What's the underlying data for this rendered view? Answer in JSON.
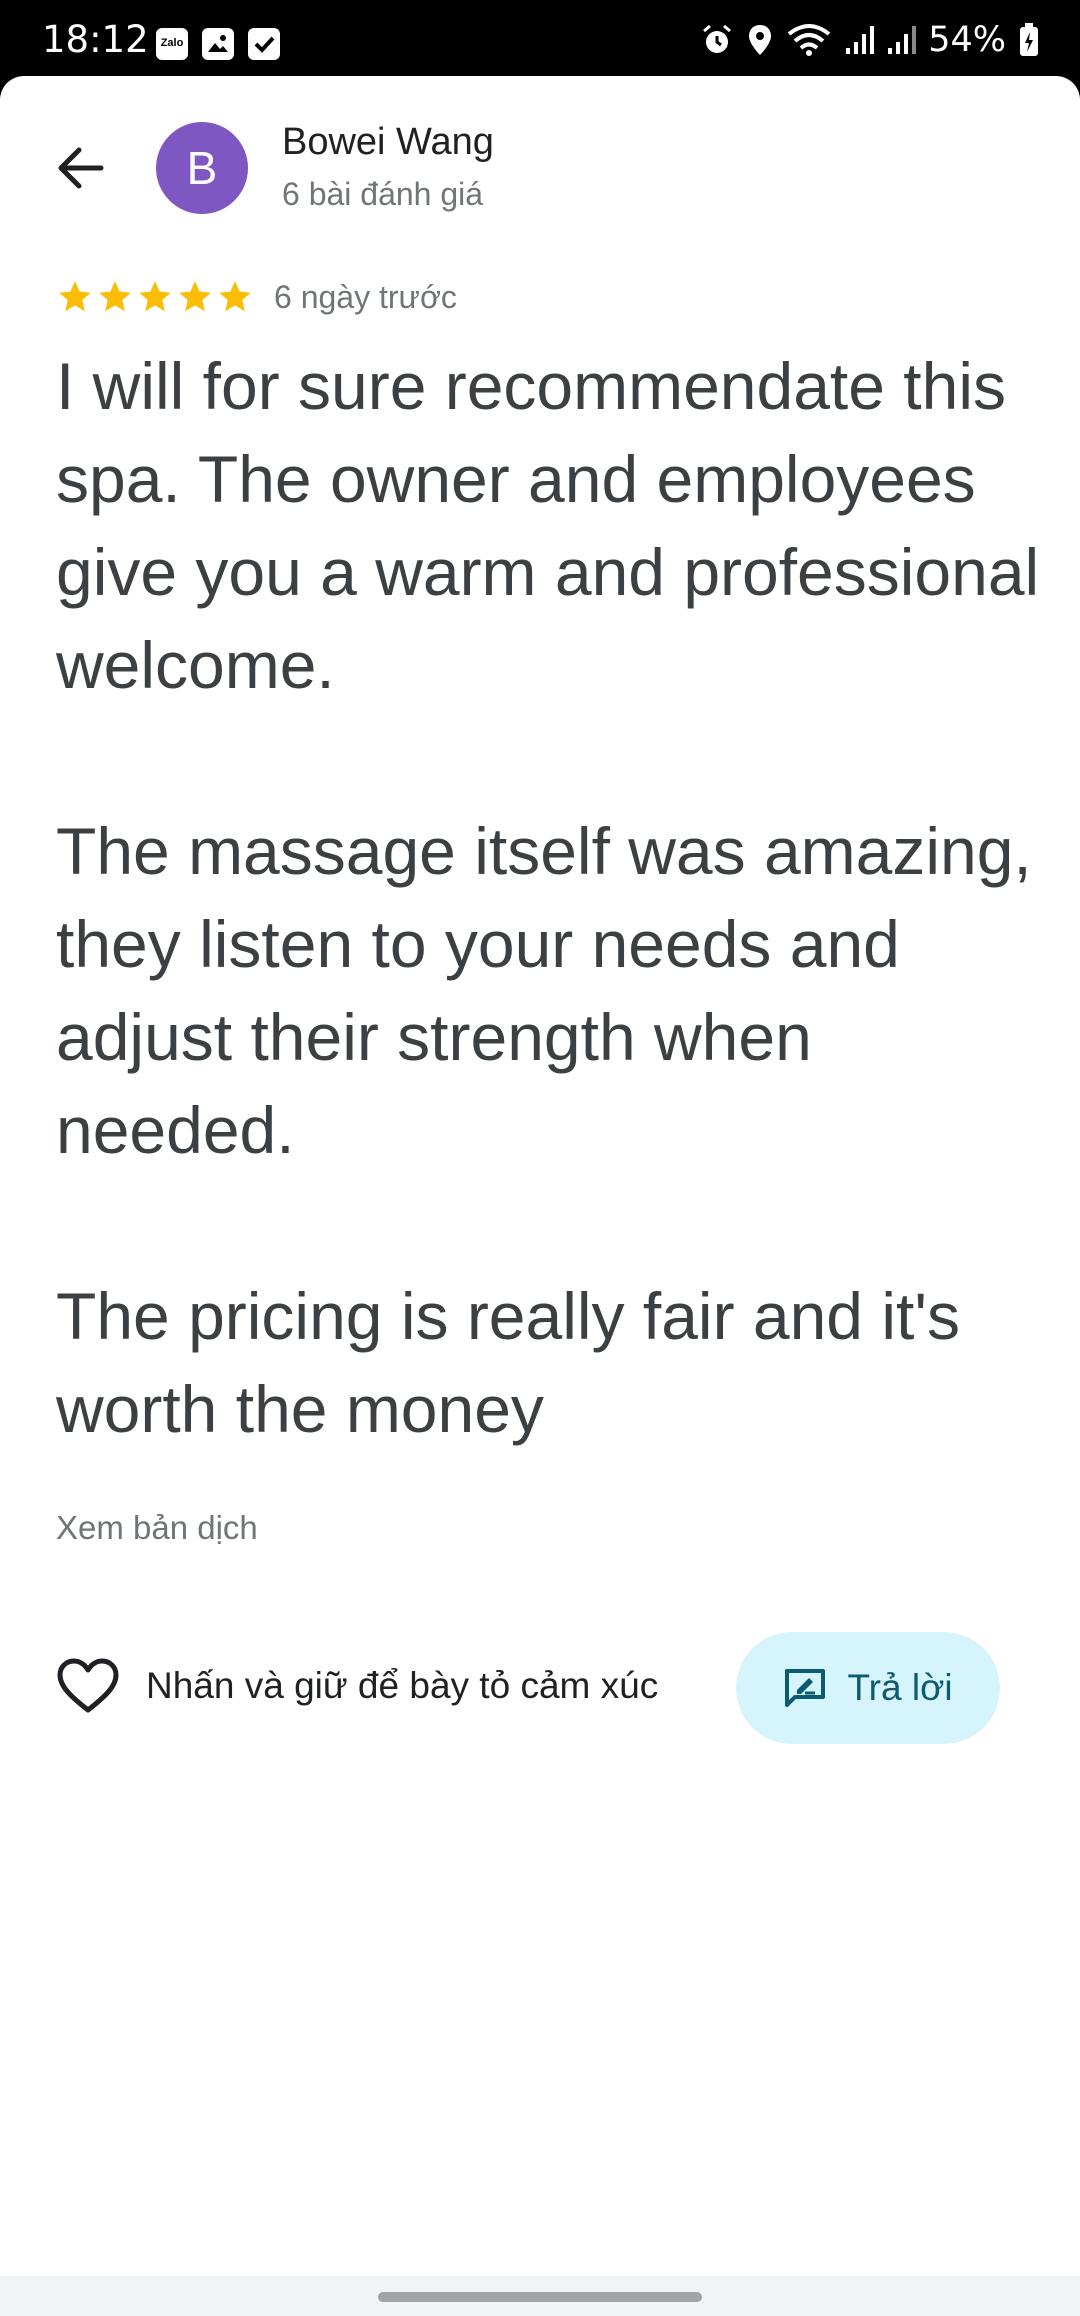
{
  "status_bar": {
    "time": "18:12",
    "left_icons": [
      "zalo-icon",
      "gallery-icon",
      "checkbox-icon"
    ],
    "right_icons": [
      "alarm-icon",
      "location-icon",
      "wifi-icon",
      "signal-icon",
      "signal-icon"
    ],
    "battery": "54%"
  },
  "header": {
    "back_icon": "arrow-left-icon",
    "avatar_letter": "B",
    "avatar_color": "#7e57c2",
    "reviewer_name": "Bowei Wang",
    "review_count": "6 bài đánh giá"
  },
  "review": {
    "rating": 5,
    "max_rating": 5,
    "star_color": "#fbbc04",
    "date": "6 ngày trước",
    "paragraphs": [
      "I will for sure recommendate this spa. The owner and employees give you a warm and professional welcome.",
      "The massage itself was amazing, they listen to your needs and adjust their strength when needed.",
      "The pricing is really fair and it's worth the money"
    ],
    "translate_link": "Xem bản dịch"
  },
  "actions": {
    "heart_icon": "heart-outline-icon",
    "reaction_label": "Nhấn và giữ để bày tỏ cảm xúc",
    "reply_icon": "reply-icon",
    "reply_label": "Trả lời",
    "reply_bg": "#d6f4fb"
  }
}
